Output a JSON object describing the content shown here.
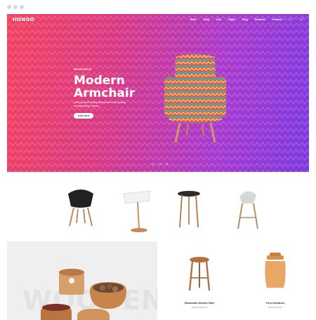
{
  "site": {
    "logo": "HONGO"
  },
  "nav": {
    "items": [
      "Home",
      "Shop",
      "Icon",
      "Pages",
      "Blog",
      "Elements",
      "Features"
    ],
    "icons": [
      "search-icon",
      "user-icon",
      "heart-icon",
      "cart-icon"
    ],
    "cart_count": "0"
  },
  "hero": {
    "price": "$99.00 $120.00",
    "title_line1": "Modern",
    "title_line2": "Armchair",
    "description": "Lorem ipsum is simply dummy text of the printing and typesetting industry.",
    "button_label": "SHOP NOW",
    "pagination": [
      "01",
      "02",
      "03"
    ],
    "colors": {
      "start": "#f2435f",
      "end": "#7c3ae0"
    }
  },
  "categories": [
    {
      "icon": "black-chair-icon"
    },
    {
      "icon": "white-lamp-icon"
    },
    {
      "icon": "side-table-icon"
    },
    {
      "icon": "bar-stool-icon"
    }
  ],
  "banner": {
    "word": "WOODEN"
  },
  "products": [
    {
      "name": "Handicrafts Wooden Table",
      "price": "$195.00  $130.00"
    },
    {
      "name": "Terra Containers",
      "price": "$30.00  $20.00"
    }
  ]
}
